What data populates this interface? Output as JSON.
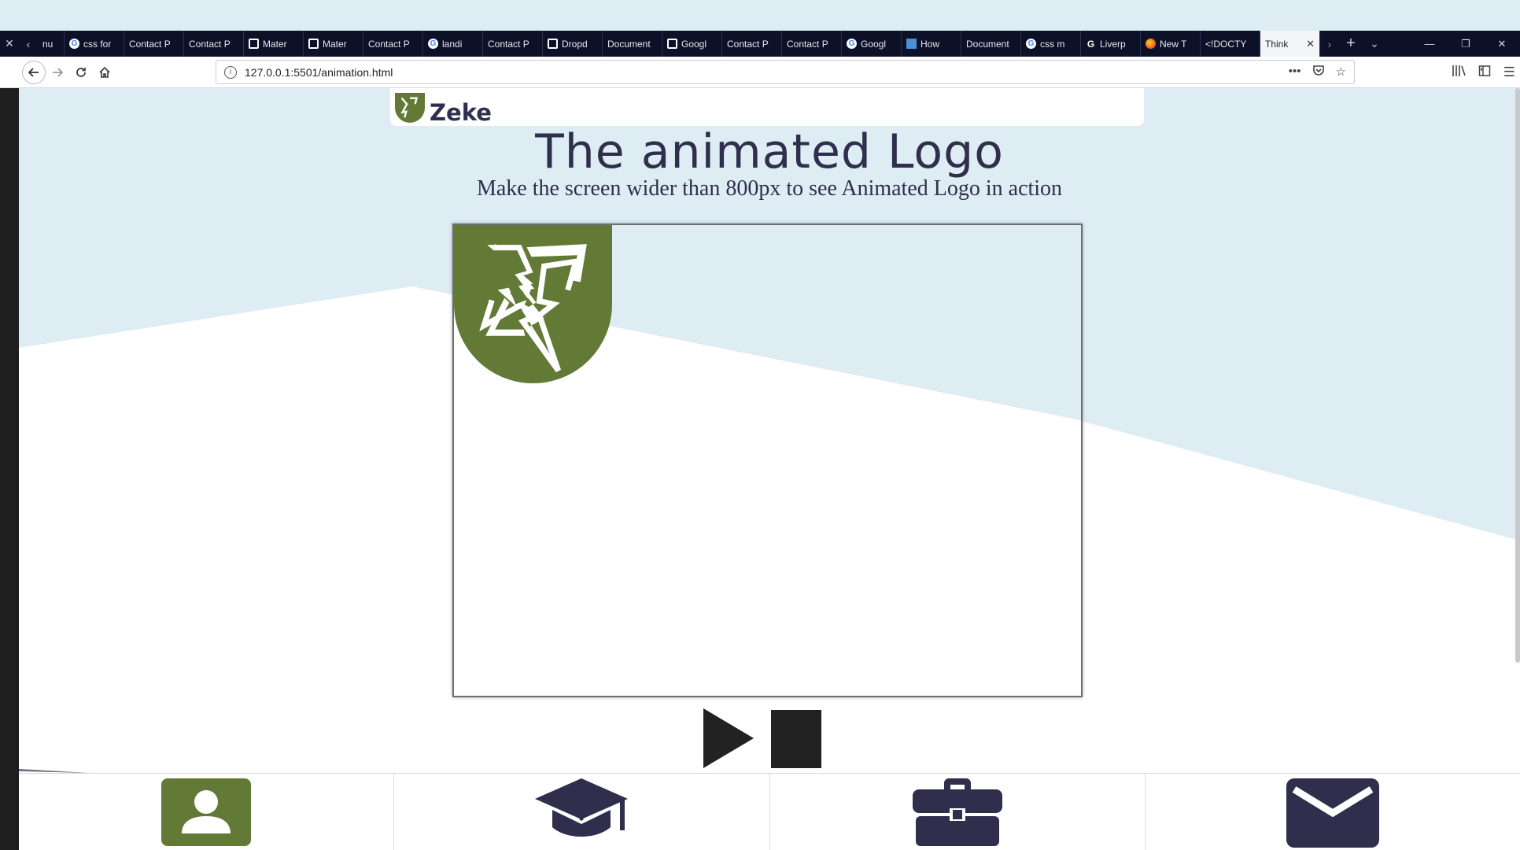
{
  "browser": {
    "tabs": [
      {
        "title": "nu",
        "icon": "blank"
      },
      {
        "title": "css for",
        "icon": "google-icon"
      },
      {
        "title": "Contact P",
        "icon": "none"
      },
      {
        "title": "Contact P",
        "icon": "none"
      },
      {
        "title": "Mater",
        "icon": "codepen-icon"
      },
      {
        "title": "Mater",
        "icon": "codepen-icon"
      },
      {
        "title": "Contact P",
        "icon": "none"
      },
      {
        "title": "landi",
        "icon": "google-icon"
      },
      {
        "title": "Contact P",
        "icon": "none"
      },
      {
        "title": "Dropd",
        "icon": "codepen-icon"
      },
      {
        "title": "Document",
        "icon": "none"
      },
      {
        "title": "Googl",
        "icon": "codepen-icon"
      },
      {
        "title": "Contact P",
        "icon": "none"
      },
      {
        "title": "Contact P",
        "icon": "none"
      },
      {
        "title": "Googl",
        "icon": "google-icon"
      },
      {
        "title": "How",
        "icon": "doc-icon"
      },
      {
        "title": "Document",
        "icon": "none"
      },
      {
        "title": "css m",
        "icon": "google-icon"
      },
      {
        "title": "Liverp",
        "icon": "g-icon"
      },
      {
        "title": "New T",
        "icon": "firefox-icon"
      },
      {
        "title": "<!DOCTY",
        "icon": "none"
      },
      {
        "title": "Think",
        "icon": "none",
        "active": true
      }
    ],
    "url": "127.0.0.1:5501/animation.html"
  },
  "header": {
    "brand_name": "Zeke"
  },
  "main": {
    "title": "The animated Logo",
    "subtitle": "Make the screen wider than 800px to see Animated Logo in action"
  },
  "controls": {
    "play_icon": "play-icon",
    "stop_icon": "stop-icon"
  },
  "bottom_nav": {
    "items": [
      {
        "icon": "person-icon",
        "color": "#637a36"
      },
      {
        "icon": "graduation-cap-icon",
        "color": "#2f2e4c"
      },
      {
        "icon": "briefcase-icon",
        "color": "#2f2e4c"
      },
      {
        "icon": "envelope-icon",
        "color": "#2f2e4c"
      }
    ]
  },
  "colors": {
    "brand_green": "#637a36",
    "brand_navy": "#2f2e4c",
    "light_blue": "#deedf4"
  }
}
